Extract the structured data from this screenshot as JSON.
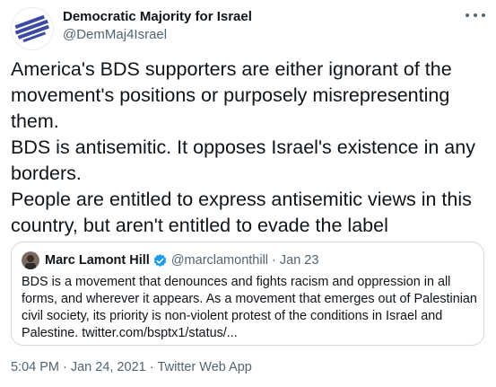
{
  "author": {
    "display_name": "Democratic Majority for Israel",
    "handle": "@DemMaj4Israel",
    "avatar_icon": "dmfi-logo-icon"
  },
  "tweet": {
    "paragraphs": [
      "America's BDS supporters are either ignorant of the movement's positions or purposely misrepresenting them.",
      "BDS is antisemitic. It opposes Israel's existence in any borders.",
      "People are entitled to express antisemitic views in this country, but aren't entitled to evade the label"
    ]
  },
  "quoted_tweet": {
    "display_name": "Marc Lamont Hill",
    "verified_icon": "verified-badge-icon",
    "handle": "@marclamonthill",
    "separator": "·",
    "date": "Jan 23",
    "body": "BDS is a movement that denounces and fights racism and oppression in all forms, and wherever it appears. As a movement that emerges out of Palestinian civil society, its priority is non-violent protest of the conditions in Israel and Palestine.",
    "link": "twitter.com/bsptx1/status/..."
  },
  "meta": {
    "time": "5:04 PM",
    "separator": "·",
    "date": "Jan 24, 2021",
    "source": "Twitter Web App"
  },
  "colors": {
    "text_primary": "#0f1419",
    "text_secondary": "#536471",
    "border": "#cfd9de",
    "verified": "#1d9bf0"
  },
  "icons": {
    "more": "more-options-icon"
  }
}
